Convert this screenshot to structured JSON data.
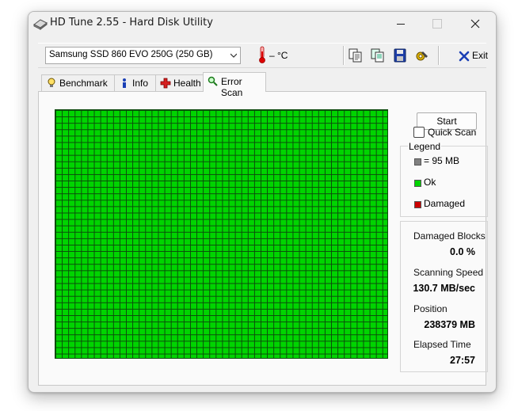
{
  "window": {
    "title": "HD Tune 2.55 - Hard Disk Utility"
  },
  "toolbar": {
    "drive": "Samsung SSD 860 EVO 250G (250 GB)",
    "temperature": "– °C",
    "exit_label": "Exit"
  },
  "tabs": [
    {
      "label": "Benchmark",
      "icon": "lightbulb-icon"
    },
    {
      "label": "Info",
      "icon": "info-icon"
    },
    {
      "label": "Health",
      "icon": "red-cross-icon"
    },
    {
      "label": "Error Scan",
      "icon": "magnifier-icon",
      "active": true
    }
  ],
  "scan": {
    "start_label": "Start",
    "quick_scan_label": "Quick Scan",
    "quick_scan_checked": false,
    "grid_status": "all blocks ok",
    "colors": {
      "ok": "#00d400",
      "damaged": "#cc0000",
      "block": "#808080"
    }
  },
  "legend": {
    "title": "Legend",
    "block_size": "= 95 MB",
    "ok": "Ok",
    "damaged": "Damaged"
  },
  "stats": {
    "damaged_blocks_label": "Damaged Blocks",
    "damaged_blocks_value": "0.0 %",
    "speed_label": "Scanning Speed",
    "speed_value": "130.7 MB/sec",
    "position_label": "Position",
    "position_value": "238379 MB",
    "elapsed_label": "Elapsed Time",
    "elapsed_value": "27:57"
  }
}
